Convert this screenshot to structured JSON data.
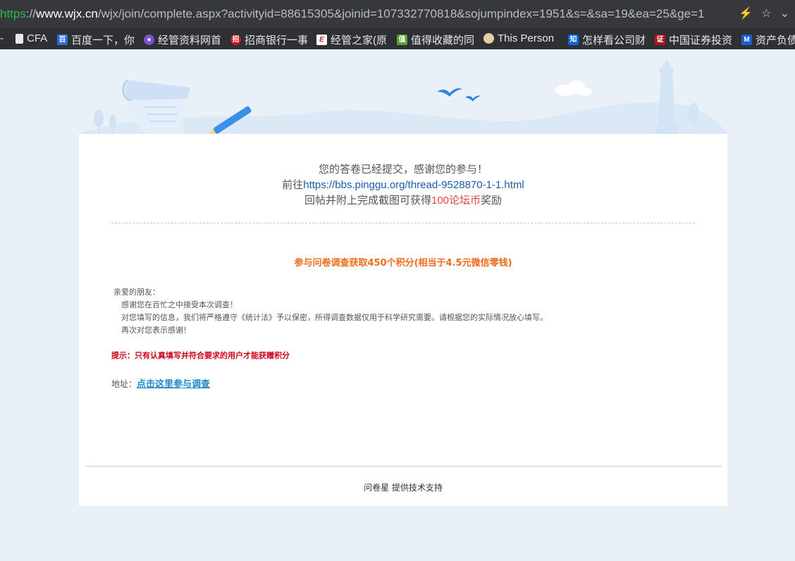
{
  "browser": {
    "url_scheme": "https",
    "url_sep": "://",
    "url_host": "www.wjx.cn",
    "url_path": "/wjx/join/complete.aspx?activityid=88615305&joinid=107332770818&sojumpindex=1951&s=&sa=19&ea=25&ge=1",
    "icons": [
      "lightning-icon",
      "star-icon",
      "chevron-down-icon"
    ]
  },
  "bookmarks": [
    {
      "label": "CFA",
      "icon": "document-icon",
      "color": "#e6e8ea"
    },
    {
      "label": "百度一下，你",
      "icon": "baidu-icon",
      "color": "#2d6be4"
    },
    {
      "label": "经管资料网首",
      "icon": "grapes-icon",
      "color": "#7a4fd0"
    },
    {
      "label": "招商银行一事",
      "icon": "cmb-icon",
      "color": "#d0161b"
    },
    {
      "label": "经管之家(原",
      "icon": "pinggu-icon",
      "color": "#c1272d"
    },
    {
      "label": "值得收藏的同",
      "icon": "zhide-icon",
      "color": "#5aa02c"
    },
    {
      "label": "This Person",
      "icon": "face-icon",
      "color": "#e8c9a8"
    },
    {
      "label": "怎样看公司财",
      "icon": "zhihu-icon",
      "color": "#0a66d8"
    },
    {
      "label": "中国证券投资",
      "icon": "securities-icon",
      "color": "#b3121f"
    },
    {
      "label": "资产负债",
      "icon": "m-icon",
      "color": "#1b5fd6"
    }
  ],
  "complete": {
    "line1": "您的答卷已经提交，感谢您的参与！",
    "line2_prefix": "前往",
    "line2_link": "https://bbs.pinggu.org/thread-9528870-1-1.html",
    "line3_prefix": "回帖并附上完成截图可获得",
    "line3_reward": "100论坛币",
    "line3_suffix": "奖励"
  },
  "promo": {
    "headline": "参与问卷调查获取450个积分(相当于4.5元微信零钱)",
    "letter": [
      "亲爱的朋友：",
      "感谢您在百忙之中接受本次调查！",
      "对您填写的信息，我们将严格遵守《统计法》予以保密，所得调查数据仅用于科学研究需要。请根据您的实际情况放心填写。",
      "再次对您表示感谢！"
    ],
    "tip": "提示：只有认真填写并符合要求的用户才能获赠积分",
    "address_label": "地址：",
    "address_link": "点击这里参与调查"
  },
  "footer": {
    "brand": "问卷星",
    "text": "提供技术支持"
  }
}
